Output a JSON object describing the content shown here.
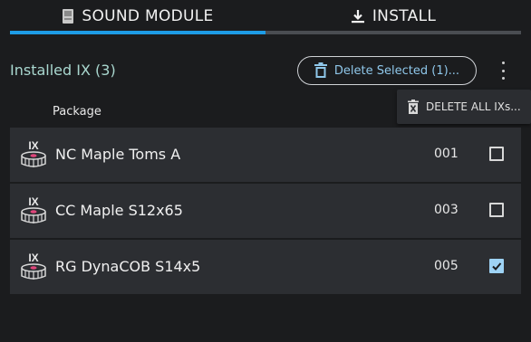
{
  "tabs": [
    {
      "label": "SOUND MODULE",
      "icon": "device-icon",
      "active": true
    },
    {
      "label": "INSTALL",
      "icon": "download-icon",
      "active": false
    }
  ],
  "header": {
    "section_title": "Installed IX (3)",
    "delete_selected_label": "Delete Selected (1)...",
    "menu_icon": "more-vert-icon"
  },
  "popup_menu": {
    "delete_all_label": "DELETE ALL IXs..."
  },
  "table": {
    "column_package": "Package",
    "rows": [
      {
        "name": "NC Maple Toms A",
        "number": "001",
        "checked": false
      },
      {
        "name": "CC Maple S12x65",
        "number": "003",
        "checked": false
      },
      {
        "name": "RG DynaCOB S14x5",
        "number": "005",
        "checked": true
      }
    ]
  },
  "colors": {
    "accent": "#1e9ce6",
    "checkbox_checked": "#9ed3f5",
    "title_text": "#a9d7cf",
    "row_bg": "#2c2e32",
    "background": "#1b1c1e"
  }
}
